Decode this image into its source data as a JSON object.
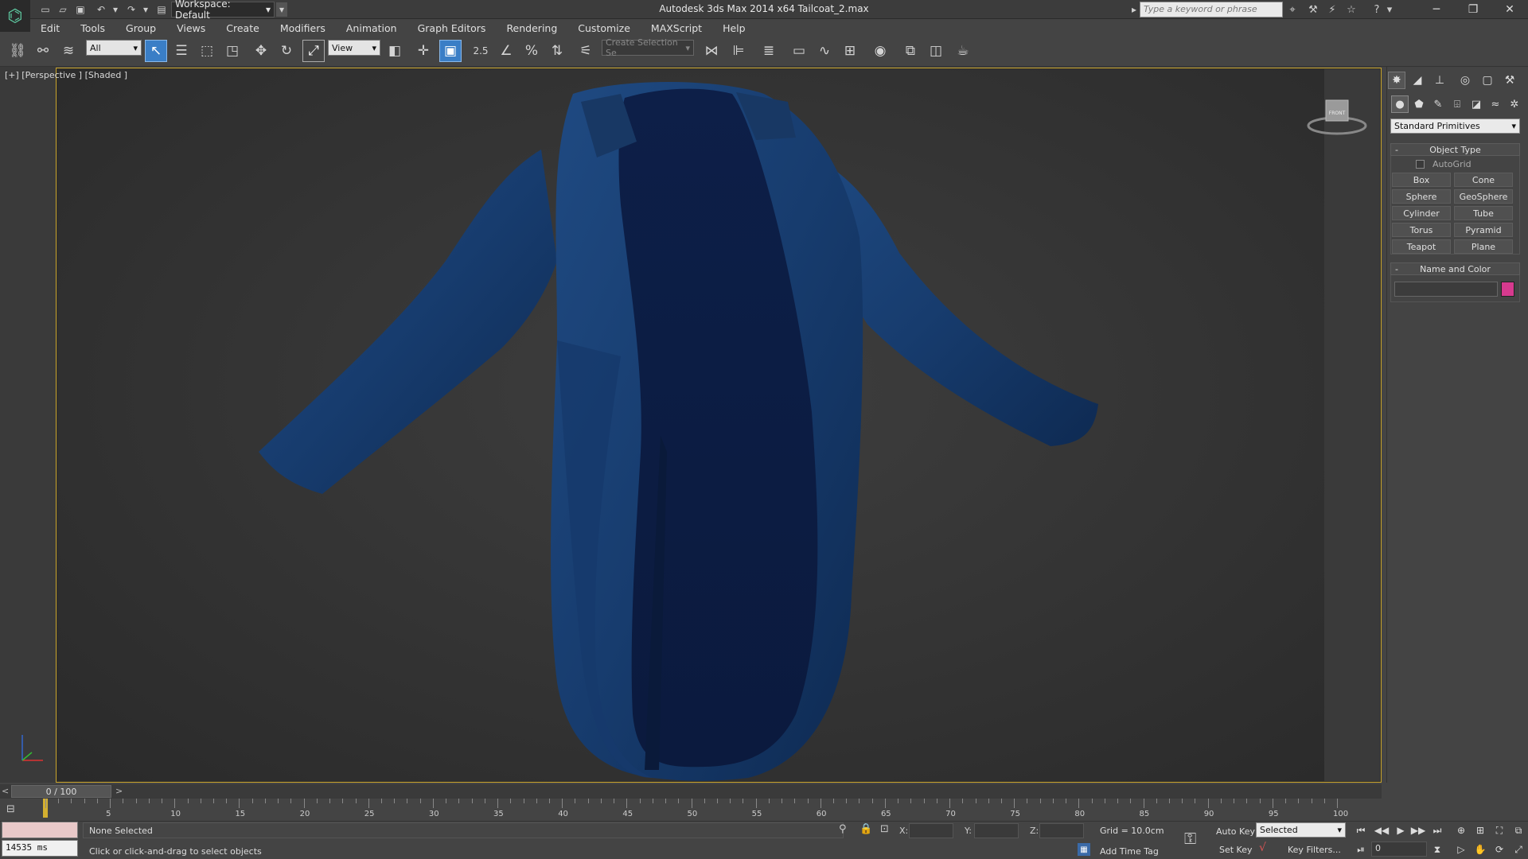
{
  "window": {
    "title": "Autodesk 3ds Max  2014 x64     Tailcoat_2.max",
    "workspace": "Workspace: Default",
    "search_placeholder": "Type a keyword or phrase",
    "minimize": "─",
    "restore": "❐",
    "close": "✕"
  },
  "menu": [
    "Edit",
    "Tools",
    "Group",
    "Views",
    "Create",
    "Modifiers",
    "Animation",
    "Graph Editors",
    "Rendering",
    "Customize",
    "MAXScript",
    "Help"
  ],
  "toolbar": {
    "filter_value": "All",
    "refcoord_value": "View",
    "snap_label": "2.5",
    "named_selection_placeholder": "Create Selection Se"
  },
  "viewport": {
    "label": "[+] [Perspective ] [Shaded ]",
    "viewcube_face": "FRONT"
  },
  "command_panel": {
    "category": "Standard Primitives",
    "object_type": {
      "title": "Object Type",
      "autogrid": "AutoGrid",
      "buttons": [
        "Box",
        "Cone",
        "Sphere",
        "GeoSphere",
        "Cylinder",
        "Tube",
        "Torus",
        "Pyramid",
        "Teapot",
        "Plane"
      ]
    },
    "name_and_color": {
      "title": "Name and Color",
      "color": "#d63a8e"
    }
  },
  "timeline": {
    "slider_label": "0 / 100",
    "prev": "<",
    "next": ">",
    "ticks": [
      "5",
      "10",
      "15",
      "20",
      "25",
      "30",
      "35",
      "40",
      "45",
      "50",
      "55",
      "60",
      "65",
      "70",
      "75",
      "80",
      "85",
      "90",
      "95",
      "100"
    ]
  },
  "status": {
    "maxscript_time": "14535 ms",
    "selection": "None Selected",
    "prompt": "Click or click-and-drag to select objects",
    "x_label": "X:",
    "y_label": "Y:",
    "z_label": "Z:",
    "grid": "Grid = 10.0cm",
    "add_time_tag": "Add Time Tag",
    "auto_key": "Auto Key",
    "set_key": "Set Key",
    "selected_value": "Selected",
    "key_filters": "Key Filters...",
    "current_frame": "0"
  }
}
